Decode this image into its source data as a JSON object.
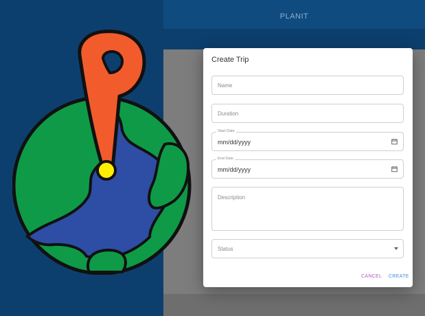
{
  "app": {
    "title": "PLANIT"
  },
  "dialog": {
    "title": "Create Trip",
    "fields": {
      "name": {
        "placeholder": "Name"
      },
      "duration": {
        "placeholder": "Duration"
      },
      "start_date": {
        "label": "Start Date",
        "value": "mm/dd/yyyy"
      },
      "end_date": {
        "label": "End Date",
        "value": "mm/dd/yyyy"
      },
      "description": {
        "placeholder": "Description"
      },
      "status": {
        "placeholder": "Status"
      }
    },
    "actions": {
      "cancel": "CANCEL",
      "create": "CREATE"
    }
  },
  "icons": {
    "logo": "globe-pin-logo",
    "calendar": "calendar-icon",
    "dropdown": "dropdown-arrow-icon"
  },
  "colors": {
    "background": "#0d3f6e",
    "appbar": "#0f4b7e",
    "backdrop": "#7d7d7d",
    "cancel": "#b455c9",
    "create": "#3d8bdc",
    "globe_land": "#0f9a48",
    "globe_water": "#2e4ea5",
    "pin": "#f25b2c",
    "pin_dot": "#ffee00"
  }
}
